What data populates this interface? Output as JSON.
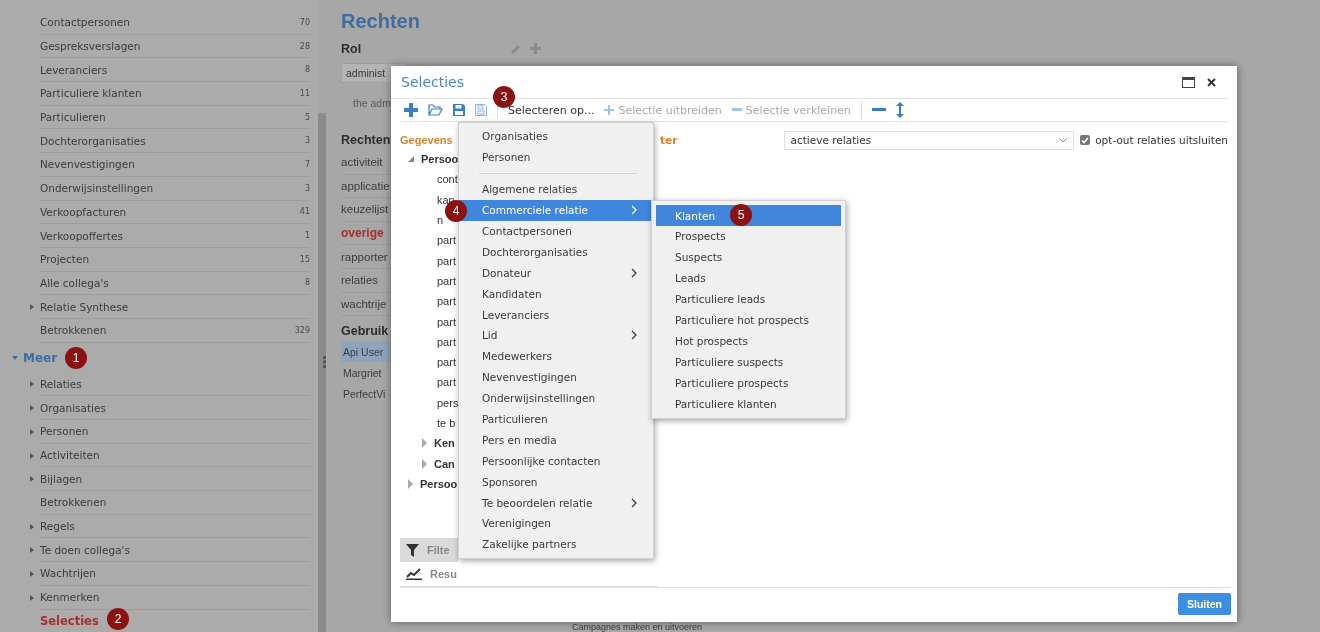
{
  "sidebar": {
    "items": [
      {
        "label": "Contactpersonen",
        "count": "70",
        "selected": false
      },
      {
        "label": "Gespreksverslagen",
        "count": "28",
        "selected": false
      },
      {
        "label": "Leveranciers",
        "count": "8",
        "selected": false
      },
      {
        "label": "Particuliere klanten",
        "count": "11",
        "selected": false
      },
      {
        "label": "Particulieren",
        "count": "5",
        "selected": false
      },
      {
        "label": "Dochterorganisaties",
        "count": "3",
        "selected": false
      },
      {
        "label": "Nevenvestigingen",
        "count": "7",
        "selected": false
      },
      {
        "label": "Onderwijsinstellingen",
        "count": "3",
        "selected": false
      },
      {
        "label": "Verkoopfacturen",
        "count": "41",
        "selected": false
      },
      {
        "label": "Verkoopoffertes",
        "count": "1",
        "selected": false
      },
      {
        "label": "Projecten",
        "count": "15",
        "selected": false
      },
      {
        "label": "Alle collega's",
        "count": "8",
        "selected": false
      },
      {
        "label": "Relatie Synthese",
        "expanded": false,
        "selected": false
      },
      {
        "label": "Betrokkenen",
        "count": "329",
        "selected": false
      },
      {
        "label": "Meer",
        "expanded": true,
        "badge": "1",
        "children": [
          {
            "label": "Relaties",
            "expanded": false,
            "selected": false
          },
          {
            "label": "Organisaties",
            "expanded": false,
            "selected": false
          },
          {
            "label": "Personen",
            "expanded": false,
            "selected": false
          },
          {
            "label": "Activiteiten",
            "expanded": false,
            "selected": false
          },
          {
            "label": "Bijlagen",
            "expanded": false,
            "selected": false
          },
          {
            "label": "Betrokkenen",
            "selected": false
          },
          {
            "label": "Regels",
            "expanded": false,
            "selected": false
          },
          {
            "label": "Te doen collega's",
            "expanded": false,
            "selected": false
          },
          {
            "label": "Wachtrijen",
            "expanded": false,
            "selected": false
          },
          {
            "label": "Kenmerken",
            "expanded": false,
            "selected": false
          },
          {
            "label": "Selecties",
            "selected": true,
            "badge": "2"
          }
        ]
      }
    ]
  },
  "page": {
    "title": "Rechten",
    "role_label": "Rol",
    "role_value": "administ",
    "role_description": "the adm",
    "rights_title": "Rechten",
    "rights": [
      {
        "label": "activiteit",
        "selected": false
      },
      {
        "label": "applicatie",
        "selected": false
      },
      {
        "label": "keuzelijst",
        "selected": false
      },
      {
        "label": "overige",
        "selected": true
      },
      {
        "label": "rapporter",
        "selected": false
      },
      {
        "label": "relaties",
        "selected": false
      },
      {
        "label": "wachtrije",
        "selected": false
      }
    ],
    "users_title": "Gebruik",
    "users": [
      {
        "label": "Api User",
        "selected": true
      },
      {
        "label": "Margriet",
        "selected": false
      },
      {
        "label": "PerfectVi",
        "selected": false
      }
    ],
    "footer_text": "Campagnes maken en uitvoeren"
  },
  "dialog": {
    "title": "Selecties",
    "toolbar": {
      "select_button": {
        "label": "Selecteren op...",
        "badge": "3"
      },
      "actions": [
        {
          "label": "Selectie uitbreiden",
          "kind": "extend",
          "disabled": true
        },
        {
          "label": "Selectie verkleinen",
          "kind": "reduce",
          "disabled": true
        }
      ]
    },
    "tree": {
      "section": "Gegevens",
      "groups": [
        {
          "label": "Persoo",
          "expanded": true,
          "children": [
            {
              "label": "cont"
            },
            {
              "label": "kan"
            },
            {
              "label": "n"
            },
            {
              "label": "part"
            },
            {
              "label": "part"
            },
            {
              "label": "part"
            },
            {
              "label": "part"
            },
            {
              "label": "part"
            },
            {
              "label": "part"
            },
            {
              "label": "part"
            },
            {
              "label": "part"
            },
            {
              "label": "pers"
            },
            {
              "label": "te b"
            },
            {
              "label": "Ken",
              "expanded": false
            },
            {
              "label": "Can",
              "expanded": false
            }
          ]
        },
        {
          "label": "Persoo",
          "expanded": false
        }
      ]
    },
    "panels": [
      {
        "label": "Filte",
        "kind": "filter",
        "selected": true
      },
      {
        "label": "Resu",
        "kind": "results",
        "selected": false
      }
    ],
    "filter": {
      "label": "ter",
      "select_value": "actieve relaties",
      "checkbox": {
        "label": "opt-out relaties uitsluiten",
        "checked": true
      }
    },
    "close_button": "Sluiten"
  },
  "menu": {
    "items": [
      {
        "kind": "item",
        "label": "Organisaties",
        "selected": false
      },
      {
        "kind": "item",
        "label": "Personen",
        "selected": false
      },
      {
        "kind": "separator"
      },
      {
        "kind": "item",
        "label": "Algemene relaties",
        "selected": false
      },
      {
        "kind": "item",
        "label": "Commerciele relatie",
        "selected": true,
        "submenu": true,
        "badge": "4"
      },
      {
        "kind": "item",
        "label": "Contactpersonen",
        "selected": false
      },
      {
        "kind": "item",
        "label": "Dochterorganisaties",
        "selected": false
      },
      {
        "kind": "item",
        "label": "Donateur",
        "selected": false,
        "submenu": true
      },
      {
        "kind": "item",
        "label": "Kandidaten",
        "selected": false
      },
      {
        "kind": "item",
        "label": "Leveranciers",
        "selected": false
      },
      {
        "kind": "item",
        "label": "Lid",
        "selected": false,
        "submenu": true
      },
      {
        "kind": "item",
        "label": "Medewerkers",
        "selected": false
      },
      {
        "kind": "item",
        "label": "Nevenvestigingen",
        "selected": false
      },
      {
        "kind": "item",
        "label": "Onderwijsinstellingen",
        "selected": false
      },
      {
        "kind": "item",
        "label": "Particulieren",
        "selected": false
      },
      {
        "kind": "item",
        "label": "Pers en media",
        "selected": false
      },
      {
        "kind": "item",
        "label": "Persoonlijke contacten",
        "selected": false
      },
      {
        "kind": "item",
        "label": "Sponsoren",
        "selected": false
      },
      {
        "kind": "item",
        "label": "Te beoordelen relatie",
        "selected": false,
        "submenu": true
      },
      {
        "kind": "item",
        "label": "Verenigingen",
        "selected": false
      },
      {
        "kind": "item",
        "label": "Zakelijke partners",
        "selected": false
      }
    ]
  },
  "submenu": {
    "items": [
      {
        "label": "Klanten",
        "selected": true,
        "badge": "5"
      },
      {
        "label": "Prospects",
        "selected": false
      },
      {
        "label": "Suspects",
        "selected": false
      },
      {
        "label": "Leads",
        "selected": false
      },
      {
        "label": "Particuliere leads",
        "selected": false
      },
      {
        "label": "Particuliere hot prospects",
        "selected": false
      },
      {
        "label": "Hot prospects",
        "selected": false
      },
      {
        "label": "Particuliere suspects",
        "selected": false
      },
      {
        "label": "Particuliere prospects",
        "selected": false
      },
      {
        "label": "Particuliere klanten",
        "selected": false
      }
    ]
  }
}
